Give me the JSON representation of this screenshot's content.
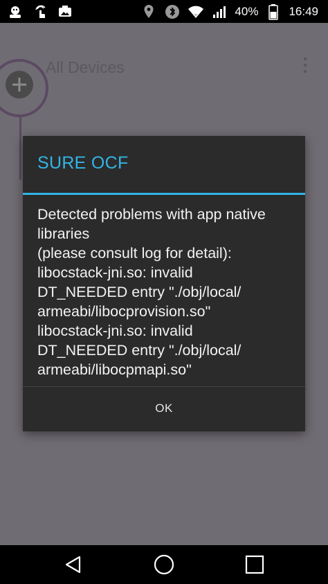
{
  "status_bar": {
    "battery_percent": "40%",
    "time": "16:49",
    "left_icons": [
      "notification-app-icon",
      "touch-icon",
      "photo-icon"
    ],
    "right_icons": [
      "location-icon",
      "bluetooth-icon",
      "wifi-icon",
      "signal-icon",
      "battery-icon"
    ]
  },
  "background_app": {
    "title": "All Devices"
  },
  "dialog": {
    "title": "SURE OCF",
    "message_lines": [
      "Detected problems with app native",
      "libraries",
      "(please consult log for detail):",
      "libocstack-jni.so: invalid",
      "DT_NEEDED entry \"./obj/local/",
      "armeabi/libocprovision.so\"",
      "libocstack-jni.so: invalid",
      "DT_NEEDED entry \"./obj/local/",
      "armeabi/libocpmapi.so\""
    ],
    "ok_label": "OK"
  },
  "colors": {
    "accent": "#33b5e5",
    "dialog_background": "#2b2b2b",
    "scrim_background": "#706c73"
  },
  "nav_bar": {
    "buttons": [
      "back-icon",
      "home-icon",
      "recents-icon"
    ]
  }
}
